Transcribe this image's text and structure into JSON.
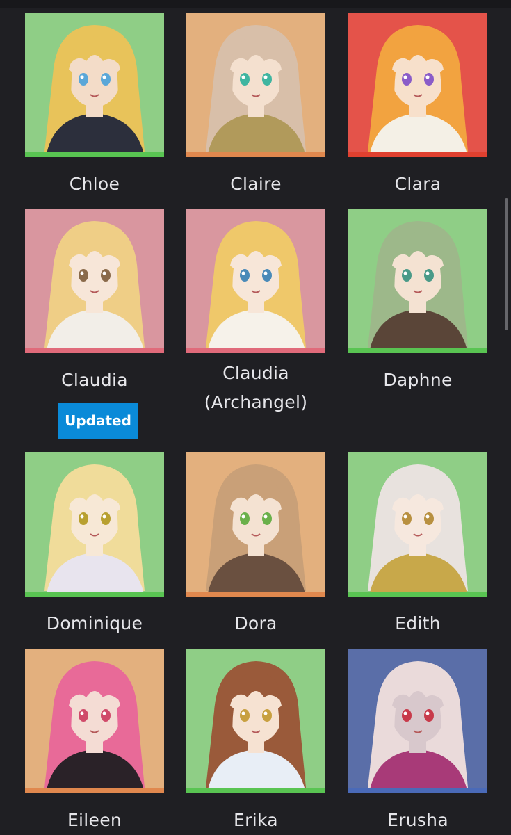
{
  "characters": [
    {
      "name": "Chloe",
      "bg": "#8fce86",
      "bar": "#59c452",
      "hair": "#e8c35a",
      "skin": "#f3dcc8",
      "outfit": "#2c2f3c",
      "eyes": "#5aa7d8"
    },
    {
      "name": "Claire",
      "bg": "#e3b07e",
      "bar": "#e0884e",
      "hair": "#d8bfa9",
      "skin": "#f4e0cf",
      "outfit": "#b19a5b",
      "eyes": "#3fb5a0"
    },
    {
      "name": "Clara",
      "bg": "#e4534a",
      "bar": "#e0402f",
      "hair": "#f2a340",
      "skin": "#f7e0cb",
      "outfit": "#f4f0e6",
      "eyes": "#8a5cc8"
    },
    {
      "name": "Claudia",
      "bg": "#d9969f",
      "bar": "#e06a7a",
      "hair": "#efce86",
      "skin": "#f7e6d8",
      "outfit": "#f2eee8",
      "eyes": "#8a6a4a",
      "badge": "Updated"
    },
    {
      "name": "Claudia\n(Archangel)",
      "bg": "#d9979f",
      "bar": "#e06a7a",
      "hair": "#efc86a",
      "skin": "#f7e6d8",
      "outfit": "#f6f2ea",
      "eyes": "#4a8ab8"
    },
    {
      "name": "Daphne",
      "bg": "#8fce86",
      "bar": "#59c452",
      "hair": "#9db88a",
      "skin": "#f4e2d2",
      "outfit": "#5a4538",
      "eyes": "#4a9a88"
    },
    {
      "name": "Dominique",
      "bg": "#8fce86",
      "bar": "#59c452",
      "hair": "#f0dc9a",
      "skin": "#f7e8d6",
      "outfit": "#e8e4ee",
      "eyes": "#b8a030"
    },
    {
      "name": "Dora",
      "bg": "#e3b07e",
      "bar": "#e0884e",
      "hair": "#c9a078",
      "skin": "#f4e2d2",
      "outfit": "#6a5040",
      "eyes": "#6ab04a"
    },
    {
      "name": "Edith",
      "bg": "#8fce86",
      "bar": "#59c452",
      "hair": "#e8e2de",
      "skin": "#f6e8de",
      "outfit": "#c8a84a",
      "eyes": "#b89040"
    },
    {
      "name": "Eileen",
      "bg": "#e3b07e",
      "bar": "#e0884e",
      "hair": "#e86a98",
      "skin": "#f4dcd4",
      "outfit": "#2a2228",
      "eyes": "#d04a6a"
    },
    {
      "name": "Erika",
      "bg": "#8fce86",
      "bar": "#59c452",
      "hair": "#9a5a3a",
      "skin": "#f6e2d2",
      "outfit": "#e8eef6",
      "eyes": "#c8a040"
    },
    {
      "name": "Erusha",
      "bg": "#5a6ea8",
      "bar": "#4a6ab8",
      "hair": "#eadada",
      "skin": "#d8c8cc",
      "outfit": "#a83a78",
      "eyes": "#c83a4a"
    }
  ]
}
